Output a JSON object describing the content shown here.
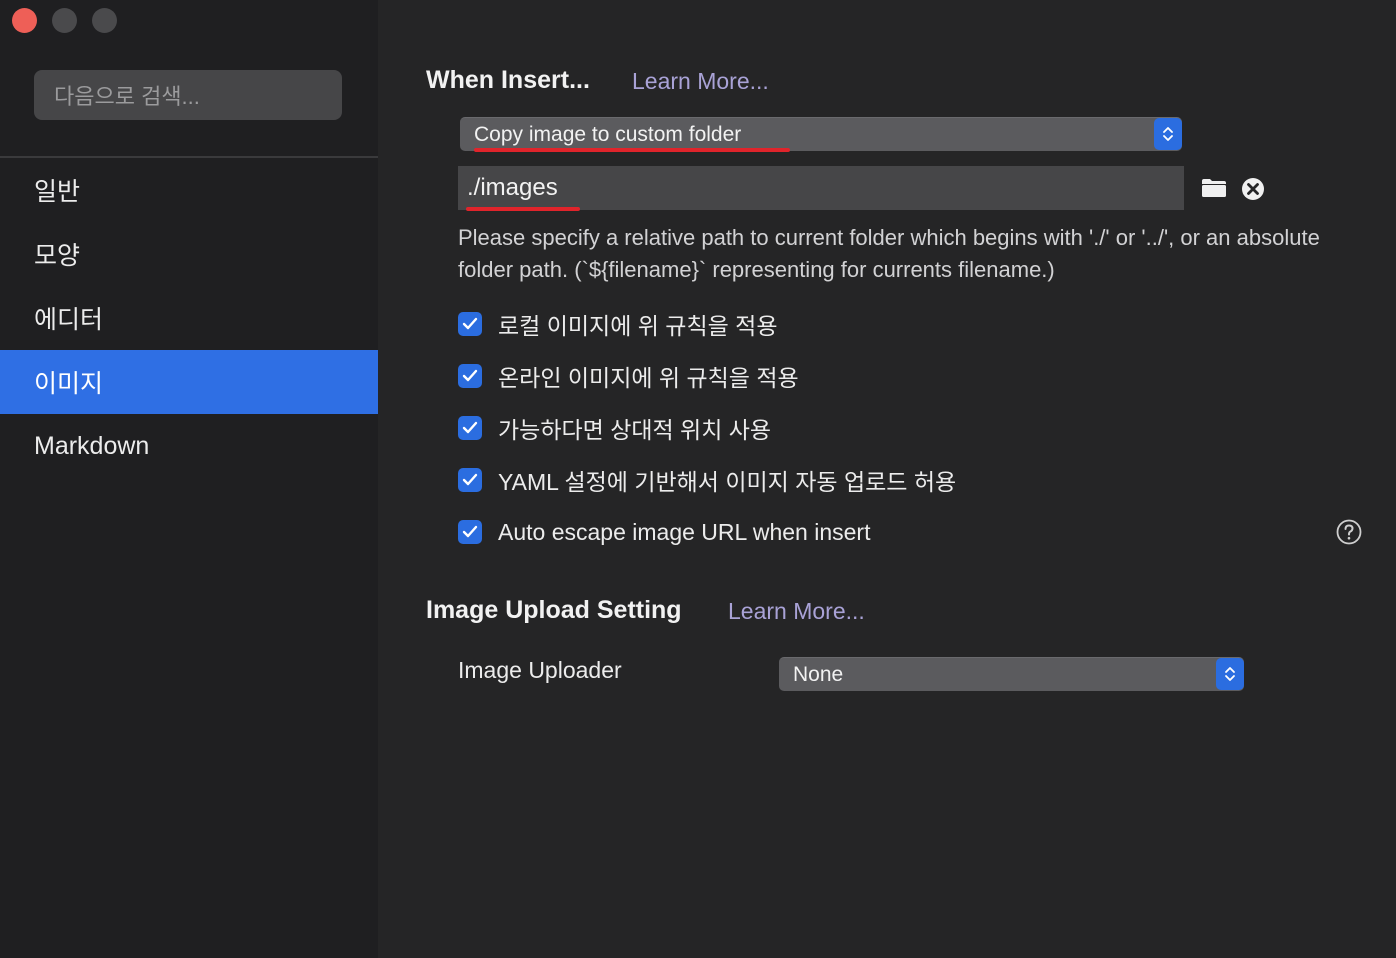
{
  "window": {
    "traffic_lights": [
      "close",
      "minimize",
      "zoom"
    ]
  },
  "sidebar": {
    "search_placeholder": "다음으로 검색...",
    "items": [
      {
        "label": "일반"
      },
      {
        "label": "모양"
      },
      {
        "label": "에디터"
      },
      {
        "label": "이미지",
        "selected": true
      },
      {
        "label": "Markdown"
      }
    ]
  },
  "when_insert": {
    "heading": "When Insert...",
    "learn_more": "Learn More...",
    "action_select": "Copy image to custom folder",
    "folder_path": "./images",
    "help_text": " Please specify a relative path to current folder which begins with './' or '../', or an absolute folder path. (`${filename}` representing for currents filename.)",
    "options": [
      {
        "label": "로컬 이미지에 위 규칙을 적용",
        "checked": true
      },
      {
        "label": "온라인 이미지에 위 규칙을 적용",
        "checked": true
      },
      {
        "label": "가능하다면 상대적 위치 사용",
        "checked": true
      },
      {
        "label": "YAML 설정에 기반해서 이미지 자동 업로드 허용",
        "checked": true
      },
      {
        "label": "Auto escape image URL when insert",
        "checked": true
      }
    ]
  },
  "image_upload": {
    "heading": "Image Upload Setting",
    "learn_more": "Learn More...",
    "uploader_label": "Image Uploader",
    "uploader_value": "None"
  },
  "colors": {
    "accent": "#2f6fe4",
    "annotation": "#e0242b",
    "close_button": "#ee5f57"
  }
}
